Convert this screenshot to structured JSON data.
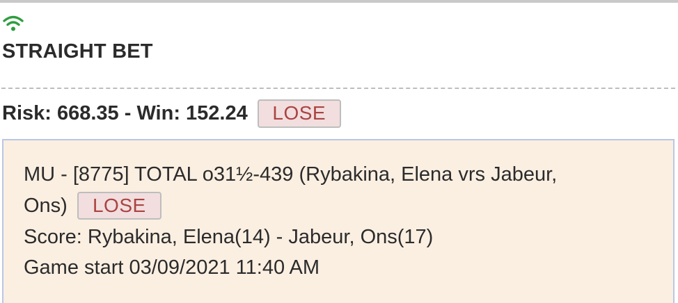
{
  "header": {
    "signal_icon": "wifi-icon",
    "signal_color": "#2e9e3e",
    "bet_type": "STRAIGHT BET"
  },
  "summary": {
    "risk_win_text": "Risk: 668.35 - Win: 152.24",
    "status": "LOSE"
  },
  "wager": {
    "description_line1": "MU - [8775] TOTAL o31½-439 (Rybakina, Elena vrs Jabeur,",
    "description_line2": "Ons)",
    "status": "LOSE",
    "score": "Score: Rybakina, Elena(14) - Jabeur, Ons(17)",
    "game_start": "Game start 03/09/2021 11:40 AM"
  },
  "colors": {
    "lose_badge_bg": "#f2dede",
    "lose_badge_text": "#a94442",
    "detail_bg": "#fbefe2",
    "detail_border": "#b9c6e6"
  }
}
